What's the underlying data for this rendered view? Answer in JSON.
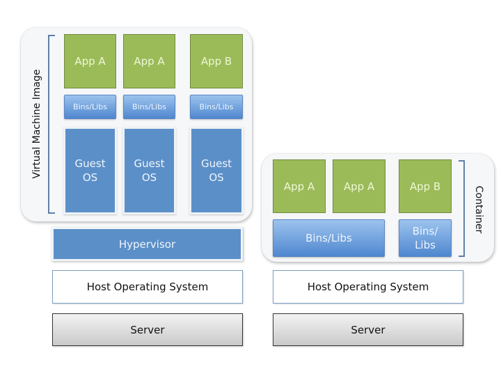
{
  "vm_stack": {
    "label": "Virtual Machine Image",
    "apps": [
      "App A",
      "App A",
      "App B"
    ],
    "libs": [
      "Bins/Libs",
      "Bins/Libs",
      "Bins/Libs"
    ],
    "guest_os": [
      "Guest OS",
      "Guest OS",
      "Guest OS"
    ],
    "hypervisor": "Hypervisor",
    "host_os": "Host Operating System",
    "server": "Server"
  },
  "container_stack": {
    "label": "Container",
    "apps": [
      "App A",
      "App A",
      "App B"
    ],
    "shared_libs": "Bins/Libs",
    "libs_b": "Bins/ Libs",
    "host_os": "Host Operating System",
    "server": "Server"
  },
  "colors": {
    "app_green": "#9bbb59",
    "libs_blue": "#4f87cf",
    "os_blue": "#5b8fc8",
    "server_gray": "#c9c9c9"
  }
}
